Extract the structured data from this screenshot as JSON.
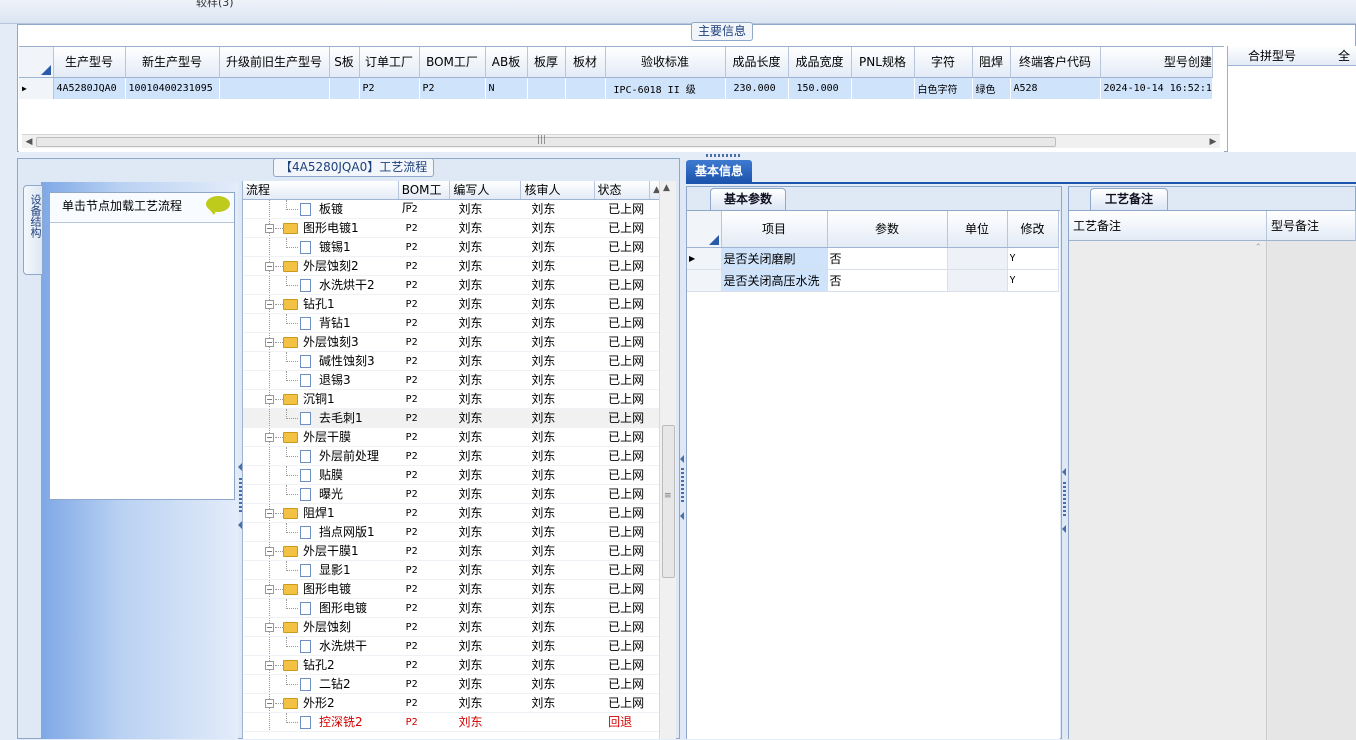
{
  "window": {
    "top_strip_text": "较样(3)"
  },
  "main_info": {
    "title": "主要信息",
    "columns": [
      "生产型号",
      "新生产型号",
      "升级前旧生产型号",
      "S板",
      "订单工厂",
      "BOM工厂",
      "AB板",
      "板厚",
      "板材",
      "验收标准",
      "成品长度",
      "成品宽度",
      "PNL规格",
      "字符",
      "阻焊",
      "终端客户代码",
      "型号创建"
    ],
    "rows": [
      [
        "4A5280JQA0",
        "10010400231095",
        "",
        "",
        "P2",
        "P2",
        "N",
        "",
        "",
        "IPC-6018 II 级",
        "230.000",
        "150.000",
        "",
        "白色字符",
        "绿色",
        "A528",
        "2024-10-14 16:52:1"
      ]
    ],
    "side_column": "合拼型号",
    "side_column2": "全"
  },
  "process_flow": {
    "title": "【4A5280JQA0】工艺流程",
    "vertical_tab": "设备结构",
    "hint": "单击节点加载工艺流程",
    "columns": [
      "流程",
      "BOM工厂",
      "编写人",
      "核审人",
      "状态"
    ],
    "rows": [
      {
        "name": "板镀",
        "level": 2,
        "bom": "P2",
        "writer": "刘东",
        "auditor": "刘东",
        "status": "已上网"
      },
      {
        "name": "图形电镀1",
        "level": 1,
        "bom": "P2",
        "writer": "刘东",
        "auditor": "刘东",
        "status": "已上网"
      },
      {
        "name": "镀锡1",
        "level": 2,
        "bom": "P2",
        "writer": "刘东",
        "auditor": "刘东",
        "status": "已上网"
      },
      {
        "name": "外层蚀刻2",
        "level": 1,
        "bom": "P2",
        "writer": "刘东",
        "auditor": "刘东",
        "status": "已上网"
      },
      {
        "name": "水洗烘干2",
        "level": 2,
        "bom": "P2",
        "writer": "刘东",
        "auditor": "刘东",
        "status": "已上网"
      },
      {
        "name": "钻孔1",
        "level": 1,
        "bom": "P2",
        "writer": "刘东",
        "auditor": "刘东",
        "status": "已上网"
      },
      {
        "name": "背钻1",
        "level": 2,
        "bom": "P2",
        "writer": "刘东",
        "auditor": "刘东",
        "status": "已上网"
      },
      {
        "name": "外层蚀刻3",
        "level": 1,
        "bom": "P2",
        "writer": "刘东",
        "auditor": "刘东",
        "status": "已上网"
      },
      {
        "name": "碱性蚀刻3",
        "level": 2,
        "bom": "P2",
        "writer": "刘东",
        "auditor": "刘东",
        "status": "已上网"
      },
      {
        "name": "退锡3",
        "level": 2,
        "bom": "P2",
        "writer": "刘东",
        "auditor": "刘东",
        "status": "已上网"
      },
      {
        "name": "沉铜1",
        "level": 1,
        "bom": "P2",
        "writer": "刘东",
        "auditor": "刘东",
        "status": "已上网"
      },
      {
        "name": "去毛刺1",
        "level": 2,
        "bom": "P2",
        "writer": "刘东",
        "auditor": "刘东",
        "status": "已上网",
        "selected": true
      },
      {
        "name": "外层干膜",
        "level": 1,
        "bom": "P2",
        "writer": "刘东",
        "auditor": "刘东",
        "status": "已上网"
      },
      {
        "name": "外层前处理",
        "level": 2,
        "bom": "P2",
        "writer": "刘东",
        "auditor": "刘东",
        "status": "已上网"
      },
      {
        "name": "贴膜",
        "level": 2,
        "bom": "P2",
        "writer": "刘东",
        "auditor": "刘东",
        "status": "已上网"
      },
      {
        "name": "曝光",
        "level": 2,
        "bom": "P2",
        "writer": "刘东",
        "auditor": "刘东",
        "status": "已上网"
      },
      {
        "name": "阻焊1",
        "level": 1,
        "bom": "P2",
        "writer": "刘东",
        "auditor": "刘东",
        "status": "已上网"
      },
      {
        "name": "挡点网版1",
        "level": 2,
        "bom": "P2",
        "writer": "刘东",
        "auditor": "刘东",
        "status": "已上网"
      },
      {
        "name": "外层干膜1",
        "level": 1,
        "bom": "P2",
        "writer": "刘东",
        "auditor": "刘东",
        "status": "已上网"
      },
      {
        "name": "显影1",
        "level": 2,
        "bom": "P2",
        "writer": "刘东",
        "auditor": "刘东",
        "status": "已上网"
      },
      {
        "name": "图形电镀",
        "level": 1,
        "bom": "P2",
        "writer": "刘东",
        "auditor": "刘东",
        "status": "已上网"
      },
      {
        "name": "图形电镀",
        "level": 2,
        "bom": "P2",
        "writer": "刘东",
        "auditor": "刘东",
        "status": "已上网"
      },
      {
        "name": "外层蚀刻",
        "level": 1,
        "bom": "P2",
        "writer": "刘东",
        "auditor": "刘东",
        "status": "已上网"
      },
      {
        "name": "水洗烘干",
        "level": 2,
        "bom": "P2",
        "writer": "刘东",
        "auditor": "刘东",
        "status": "已上网"
      },
      {
        "name": "钻孔2",
        "level": 1,
        "bom": "P2",
        "writer": "刘东",
        "auditor": "刘东",
        "status": "已上网"
      },
      {
        "name": "二钻2",
        "level": 2,
        "bom": "P2",
        "writer": "刘东",
        "auditor": "刘东",
        "status": "已上网"
      },
      {
        "name": "外形2",
        "level": 1,
        "bom": "P2",
        "writer": "刘东",
        "auditor": "刘东",
        "status": "已上网"
      },
      {
        "name": "控深铣2",
        "level": 2,
        "bom": "P2",
        "writer": "刘东",
        "auditor": "",
        "status": "回退",
        "red": true
      }
    ]
  },
  "basic_info": {
    "tab": "基本信息",
    "subtab": "基本参数",
    "columns": [
      "项目",
      "参数",
      "单位",
      "修改"
    ],
    "rows": [
      [
        "是否关闭磨刷",
        "否",
        "",
        "Y"
      ],
      [
        "是否关闭高压水洗",
        "否",
        "",
        "Y"
      ]
    ]
  },
  "process_notes": {
    "subtab": "工艺备注",
    "columns": [
      "工艺备注",
      "型号备注"
    ]
  },
  "colors": {
    "selection": "#cfe3fb",
    "accent": "#1d54ad",
    "reject": "#d40000"
  }
}
